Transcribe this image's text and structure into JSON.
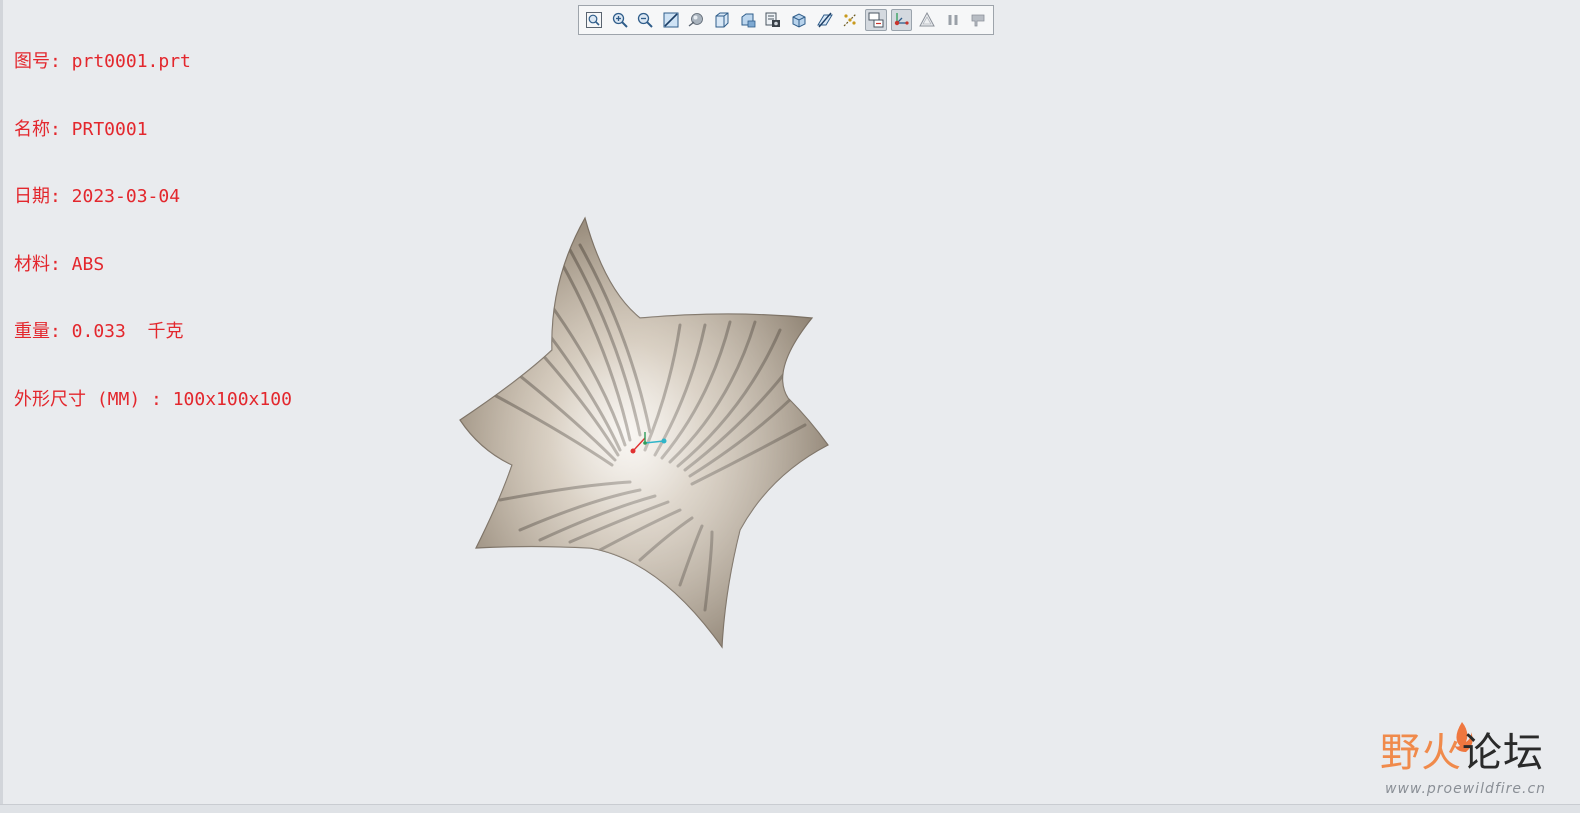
{
  "info": {
    "drawing_number": "图号: prt0001.prt",
    "name": "名称: PRT0001",
    "date": "日期: 2023-03-04",
    "material": "材料: ABS",
    "weight": "重量: 0.033  千克",
    "dimensions": "外形尺寸 (MM) : 100x100x100",
    "text_color": "#e3272d"
  },
  "toolbar": {
    "buttons": [
      {
        "icon": "zoom-fit-icon"
      },
      {
        "icon": "zoom-in-icon"
      },
      {
        "icon": "zoom-out-icon"
      },
      {
        "icon": "repaint-icon"
      },
      {
        "icon": "spin-center-icon"
      },
      {
        "icon": "view-orientation-icon"
      },
      {
        "icon": "saved-views-icon"
      },
      {
        "icon": "view-manager-icon"
      },
      {
        "icon": "display-style-icon"
      },
      {
        "icon": "section-icon"
      },
      {
        "icon": "datum-display-icon"
      },
      {
        "icon": "annotation-display-icon",
        "active": true
      },
      {
        "icon": "csys-display-icon",
        "active": true
      },
      {
        "icon": "triangle-display-icon"
      },
      {
        "icon": "pause-icon"
      },
      {
        "icon": "flag-icon"
      }
    ]
  },
  "watermark": {
    "part1": "野火",
    "part2": "论坛",
    "url": "www.proewildfire.cn"
  },
  "colors": {
    "background": "#e9ebee",
    "model": "#b7aa99",
    "accent_active": "#d4d9df"
  }
}
